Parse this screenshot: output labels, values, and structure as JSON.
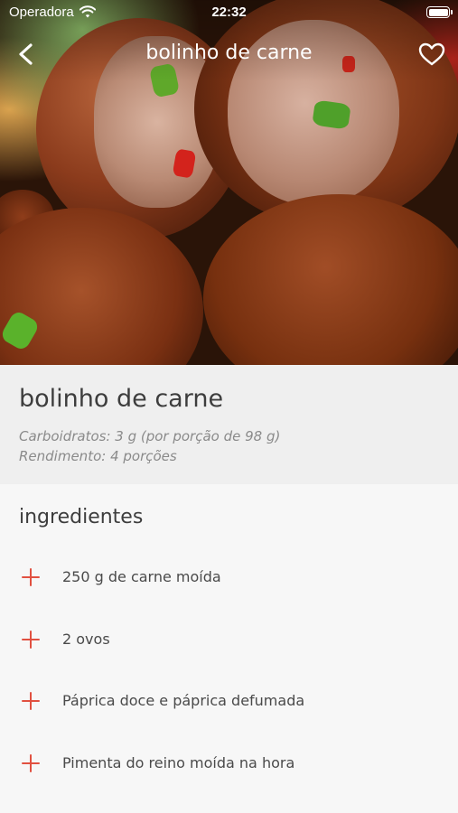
{
  "status_bar": {
    "carrier": "Operadora",
    "time": "22:32",
    "icons": [
      "wifi-icon",
      "battery-icon"
    ]
  },
  "nav": {
    "title": "bolinho de carne",
    "back_icon": "chevron-left-icon",
    "favorite_icon": "heart-outline-icon"
  },
  "recipe": {
    "title": "bolinho de carne",
    "carbs": "Carboidratos: 3 g (por porção de 98 g)",
    "yield": "Rendimento: 4 porções"
  },
  "ingredients": {
    "heading": "ingredientes",
    "items": [
      {
        "label": "250 g de carne moída"
      },
      {
        "label": "2 ovos"
      },
      {
        "label": "Páprica doce e páprica defumada"
      },
      {
        "label": "Pimenta do reino moída na hora"
      }
    ]
  },
  "colors": {
    "accent": "#e15040",
    "background": "#f7f7f7",
    "info_background": "#efefef"
  }
}
